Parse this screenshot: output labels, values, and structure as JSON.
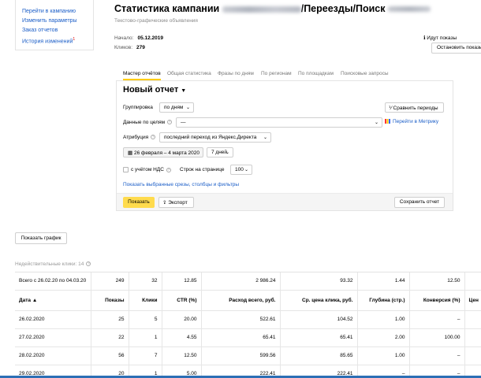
{
  "left_nav": [
    {
      "label": "Перейти в кампанию"
    },
    {
      "label": "Изменить параметры"
    },
    {
      "label": "Заказ отчетов"
    },
    {
      "label": "История изменений",
      "badge": "1"
    }
  ],
  "header": {
    "title_prefix": "Статистика кампании",
    "title_path": "/Переезды/Поиск",
    "subtitle": "Текстово-графические объявления",
    "start_label": "Начало:",
    "start_value": "05.12.2019",
    "clicks_label": "Кликов:",
    "clicks_value": "279",
    "shows_status": "Идут показы",
    "stop_button": "Остановить показы"
  },
  "tabs": [
    "Мастер отчётов",
    "Общая статистика",
    "Фразы по дням",
    "По регионам",
    "По площадкам",
    "Поисковые запросы"
  ],
  "report": {
    "name": "Новый отчет",
    "grouping_label": "Группировка",
    "grouping_value": "по дням",
    "compare_button": "Сравнить периоды",
    "goals_label": "Данные по целям",
    "goals_value": "—",
    "metrika_link": "Перейти в Метрику",
    "attribution_label": "Атрибуция",
    "attribution_value": "последний переход из Яндекс.Директа",
    "date_range": "26 февраля – 4 марта 2020",
    "period": "7 дней",
    "vat_label": "с учётом НДС",
    "rows_label": "Строк на странице",
    "rows_value": "100",
    "show_slices_link": "Показать выбранные срезы, столбцы и фильтры",
    "show_button": "Показать",
    "export_button": "Экспорт",
    "save_button": "Сохранить отчет"
  },
  "graph_button": "Показать график",
  "invalid_clicks": "Недействительные клики: 14",
  "table": {
    "total_label": "Всего с 26.02.20 по 04.03.20",
    "totals": [
      "249",
      "32",
      "12.85",
      "2 986.24",
      "93.32",
      "1.44",
      "12.50",
      ""
    ],
    "columns": [
      "Дата ▲",
      "Показы",
      "Клики",
      "CTR (%)",
      "Расход всего, руб.",
      "Ср. цена клика, руб.",
      "Глубина (стр.)",
      "Конверсия (%)",
      "Цен"
    ],
    "rows": [
      [
        "26.02.2020",
        "25",
        "5",
        "20.00",
        "522.61",
        "104.52",
        "1.00",
        "–",
        ""
      ],
      [
        "27.02.2020",
        "22",
        "1",
        "4.55",
        "65.41",
        "65.41",
        "2.00",
        "100.00",
        ""
      ],
      [
        "28.02.2020",
        "56",
        "7",
        "12.50",
        "599.56",
        "85.65",
        "1.00",
        "–",
        ""
      ],
      [
        "29.02.2020",
        "20",
        "1",
        "5.00",
        "222.41",
        "222.41",
        "–",
        "–",
        ""
      ]
    ]
  },
  "colors": {
    "accent_yellow": "#ffdb4d",
    "link_blue": "#1a5dc7"
  }
}
